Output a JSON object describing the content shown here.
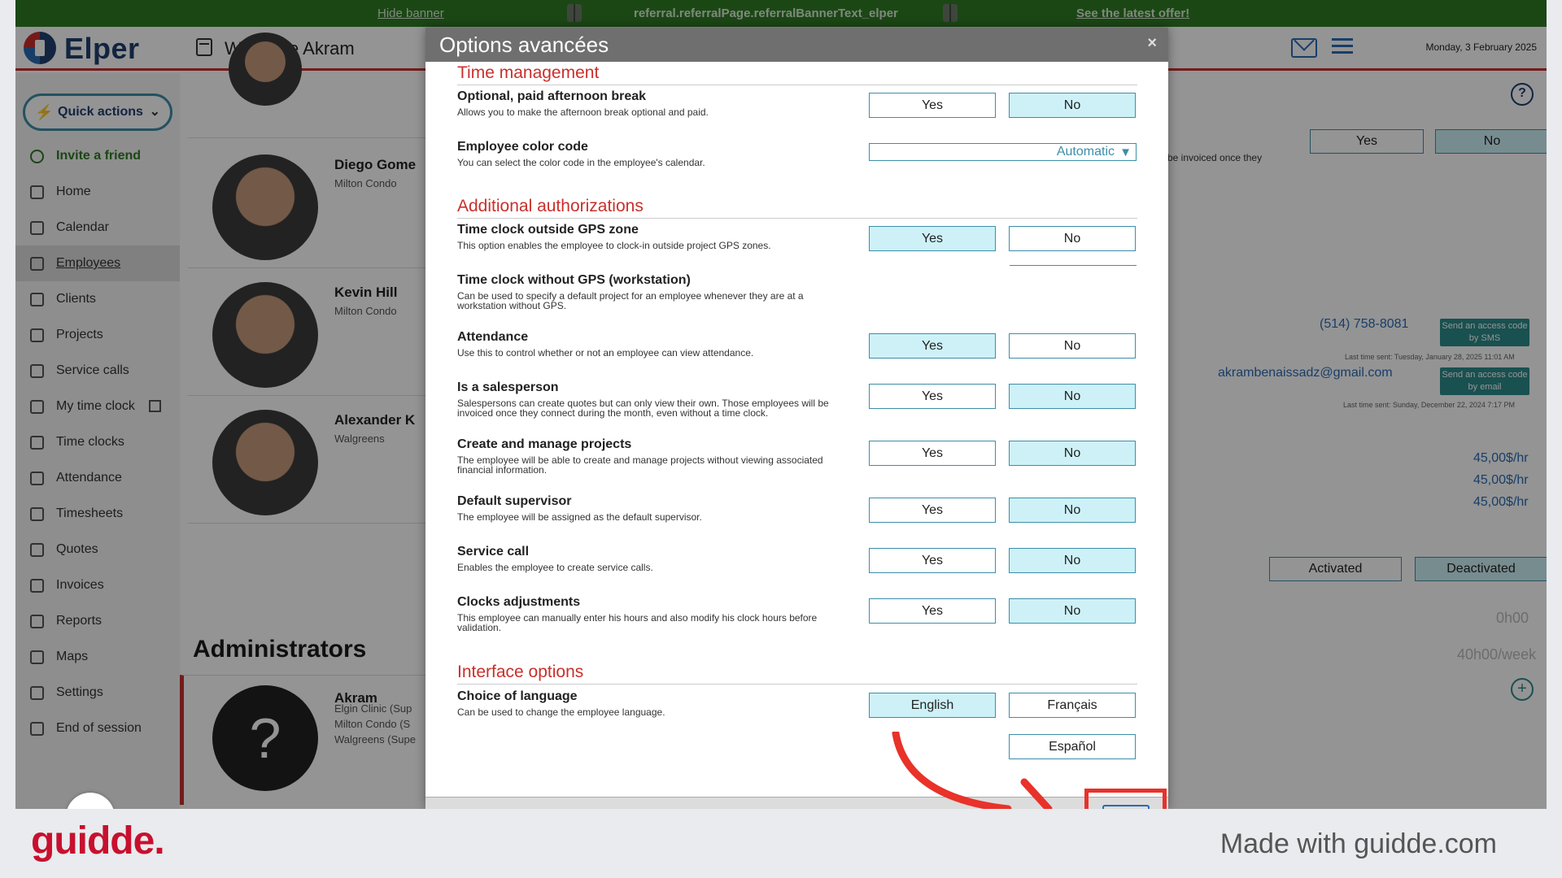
{
  "banner": {
    "hide": "Hide banner",
    "text": "referral.referralPage.referralBannerText_elper",
    "offer": "See the latest offer!"
  },
  "header": {
    "logo": "Elper",
    "welcome": "Welcome Akram",
    "date": "Monday, 3 February 2025"
  },
  "sidebar": {
    "quick_actions": "Quick actions",
    "items": [
      {
        "label": "Invite a friend",
        "icon": "heart-icon"
      },
      {
        "label": "Home",
        "icon": "home-icon"
      },
      {
        "label": "Calendar",
        "icon": "calendar-icon"
      },
      {
        "label": "Employees",
        "icon": "users-icon"
      },
      {
        "label": "Clients",
        "icon": "crown-icon"
      },
      {
        "label": "Projects",
        "icon": "folders-icon"
      },
      {
        "label": "Service calls",
        "icon": "phone-icon"
      },
      {
        "label": "My time clock",
        "icon": "clock-icon"
      },
      {
        "label": "Time clocks",
        "icon": "clock-icon"
      },
      {
        "label": "Attendance",
        "icon": "person-icon"
      },
      {
        "label": "Timesheets",
        "icon": "sheet-icon"
      },
      {
        "label": "Quotes",
        "icon": "calculator-icon"
      },
      {
        "label": "Invoices",
        "icon": "dollar-icon"
      },
      {
        "label": "Reports",
        "icon": "clipboard-icon"
      },
      {
        "label": "Maps",
        "icon": "map-icon"
      },
      {
        "label": "Settings",
        "icon": "gear-icon"
      },
      {
        "label": "End of session",
        "icon": "logout-icon"
      }
    ]
  },
  "employees": [
    {
      "name": "Diego Gome",
      "sub": "Milton Condo"
    },
    {
      "name": "Kevin Hill",
      "sub": "Milton Condo"
    },
    {
      "name": "Alexander K",
      "sub": "Walgreens"
    }
  ],
  "admins": {
    "title": "Administrators",
    "name": "Akram",
    "sub1": "Elgin Clinic (Sup",
    "sub2": "Milton Condo (S",
    "sub3": "Walgreens (Supe",
    "avatar": "?"
  },
  "right": {
    "yes": "Yes",
    "no": "No",
    "invoiced_note": "be invoiced once they",
    "phone": "(514) 758-8081",
    "send_sms": "Send an access code by SMS",
    "last_sms": "Last time sent: Tuesday, January 28, 2025 11:01 AM",
    "email": "akrambenaissadz@gmail.com",
    "send_email": "Send an access code by email",
    "last_email": "Last time sent: Sunday, December 22, 2024 7:17 PM",
    "rate1": "45,00$/hr",
    "rate2": "45,00$/hr",
    "rate3": "45,00$/hr",
    "activated": "Activated",
    "deactivated": "Deactivated",
    "hours": "0h00",
    "week": "40h00/week",
    "help": "?",
    "plus": "+"
  },
  "modal": {
    "title": "Options avancées",
    "close": "×",
    "sections": {
      "time": "Time management",
      "auth": "Additional authorizations",
      "iface": "Interface options"
    },
    "options": {
      "break_t": "Optional, paid afternoon break",
      "break_d": "Allows you to make the afternoon break optional and paid.",
      "color_t": "Employee color code",
      "color_d": "You can select the color code in the employee's calendar.",
      "color_val": "Automatic",
      "gps_t": "Time clock outside GPS zone",
      "gps_d": "This option enables the employee to clock-in outside project GPS zones.",
      "nogps_t": "Time clock without GPS (workstation)",
      "nogps_d": "Can be used to specify a default project for an employee whenever they are at a workstation without GPS.",
      "att_t": "Attendance",
      "att_d": "Use this to control whether or not an employee can view attendance.",
      "sales_t": "Is a salesperson",
      "sales_d": "Salespersons can create quotes but can only view their own. Those employees will be invoiced once they connect during the month, even without a time clock.",
      "proj_t": "Create and manage projects",
      "proj_d": "The employee will be able to create and manage projects without viewing associated financial information.",
      "sup_t": "Default supervisor",
      "sup_d": "The employee will be assigned as the default supervisor.",
      "svc_t": "Service call",
      "svc_d": "Enables the employee to create service calls.",
      "adj_t": "Clocks adjustments",
      "adj_d": "This employee can manually enter his hours and also modify his clock hours before validation.",
      "lang_t": "Choice of language",
      "lang_d": "Can be used to change the employee language."
    },
    "yes": "Yes",
    "no": "No",
    "langs": {
      "en": "English",
      "fr": "Français",
      "es": "Español"
    }
  },
  "footer": {
    "brand": "guidde.",
    "made": "Made with guidde.com"
  },
  "colors": {
    "accent": "#c9302c",
    "selected": "#cdf1f7",
    "border": "#3d8ea8",
    "banner": "#2f7a25"
  }
}
